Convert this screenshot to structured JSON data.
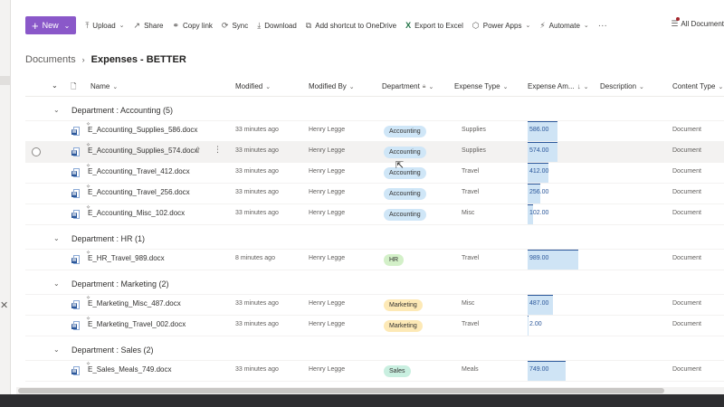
{
  "command_bar": {
    "new_label": "New",
    "items": [
      {
        "label": "Upload",
        "icon": "upload-icon",
        "glyph": "⤒",
        "has_chevron": true
      },
      {
        "label": "Share",
        "icon": "share-icon",
        "glyph": "↗"
      },
      {
        "label": "Copy link",
        "icon": "link-icon",
        "glyph": "⚭"
      },
      {
        "label": "Sync",
        "icon": "sync-icon",
        "glyph": "⟳"
      },
      {
        "label": "Download",
        "icon": "download-icon",
        "glyph": "⤓"
      },
      {
        "label": "Add shortcut to OneDrive",
        "icon": "shortcut-icon",
        "glyph": "⧉"
      },
      {
        "label": "Export to Excel",
        "icon": "excel-icon",
        "glyph": "X"
      },
      {
        "label": "Power Apps",
        "icon": "power-apps-icon",
        "glyph": "⬡",
        "has_chevron": true
      },
      {
        "label": "Automate",
        "icon": "automate-icon",
        "glyph": "⚡",
        "has_chevron": true
      }
    ],
    "more": "···",
    "view_label": "All Document"
  },
  "breadcrumb": {
    "parent": "Documents",
    "current": "Expenses - BETTER"
  },
  "columns": {
    "name": "Name",
    "modified": "Modified",
    "modified_by": "Modified By",
    "department": "Department",
    "expense_type": "Expense Type",
    "expense_amount": "Expense Am...",
    "description": "Description",
    "content_type": "Content Type"
  },
  "groups": [
    {
      "title": "Department : Accounting (5)",
      "rows": [
        {
          "name": "E_Accounting_Supplies_586.docx",
          "modified": "33 minutes ago",
          "modified_by": "Henry Legge",
          "department": "Accounting",
          "expense_type": "Supplies",
          "amount": "586.00",
          "amount_value": 586,
          "content_type": "Document"
        },
        {
          "name": "E_Accounting_Supplies_574.docx",
          "modified": "33 minutes ago",
          "modified_by": "Henry Legge",
          "department": "Accounting",
          "expense_type": "Supplies",
          "amount": "574.00",
          "amount_value": 574,
          "content_type": "Document",
          "hover": true
        },
        {
          "name": "E_Accounting_Travel_412.docx",
          "modified": "33 minutes ago",
          "modified_by": "Henry Legge",
          "department": "Accounting",
          "expense_type": "Travel",
          "amount": "412.00",
          "amount_value": 412,
          "content_type": "Document"
        },
        {
          "name": "E_Accounting_Travel_256.docx",
          "modified": "33 minutes ago",
          "modified_by": "Henry Legge",
          "department": "Accounting",
          "expense_type": "Travel",
          "amount": "256.00",
          "amount_value": 256,
          "content_type": "Document"
        },
        {
          "name": "E_Accounting_Misc_102.docx",
          "modified": "33 minutes ago",
          "modified_by": "Henry Legge",
          "department": "Accounting",
          "expense_type": "Misc",
          "amount": "102.00",
          "amount_value": 102,
          "content_type": "Document"
        }
      ]
    },
    {
      "title": "Department : HR (1)",
      "rows": [
        {
          "name": "E_HR_Travel_989.docx",
          "modified": "8 minutes ago",
          "modified_by": "Henry Legge",
          "department": "HR",
          "expense_type": "Travel",
          "amount": "989.00",
          "amount_value": 989,
          "content_type": "Document"
        }
      ]
    },
    {
      "title": "Department : Marketing (2)",
      "rows": [
        {
          "name": "E_Marketing_Misc_487.docx",
          "modified": "33 minutes ago",
          "modified_by": "Henry Legge",
          "department": "Marketing",
          "expense_type": "Misc",
          "amount": "487.00",
          "amount_value": 487,
          "content_type": "Document"
        },
        {
          "name": "E_Marketing_Travel_002.docx",
          "modified": "33 minutes ago",
          "modified_by": "Henry Legge",
          "department": "Marketing",
          "expense_type": "Travel",
          "amount": "2.00",
          "amount_value": 2,
          "content_type": "Document"
        }
      ]
    },
    {
      "title": "Department : Sales (2)",
      "rows": [
        {
          "name": "E_Sales_Meals_749.docx",
          "modified": "33 minutes ago",
          "modified_by": "Henry Legge",
          "department": "Sales",
          "expense_type": "Meals",
          "amount": "749.00",
          "amount_value": 749,
          "content_type": "Document"
        }
      ]
    }
  ],
  "dept_colors": {
    "Accounting": "#cfe6f7",
    "HR": "#d3f0c8",
    "Marketing": "#fde9b6",
    "Sales": "#c9efe0"
  },
  "accent_color": "#8a58c9"
}
